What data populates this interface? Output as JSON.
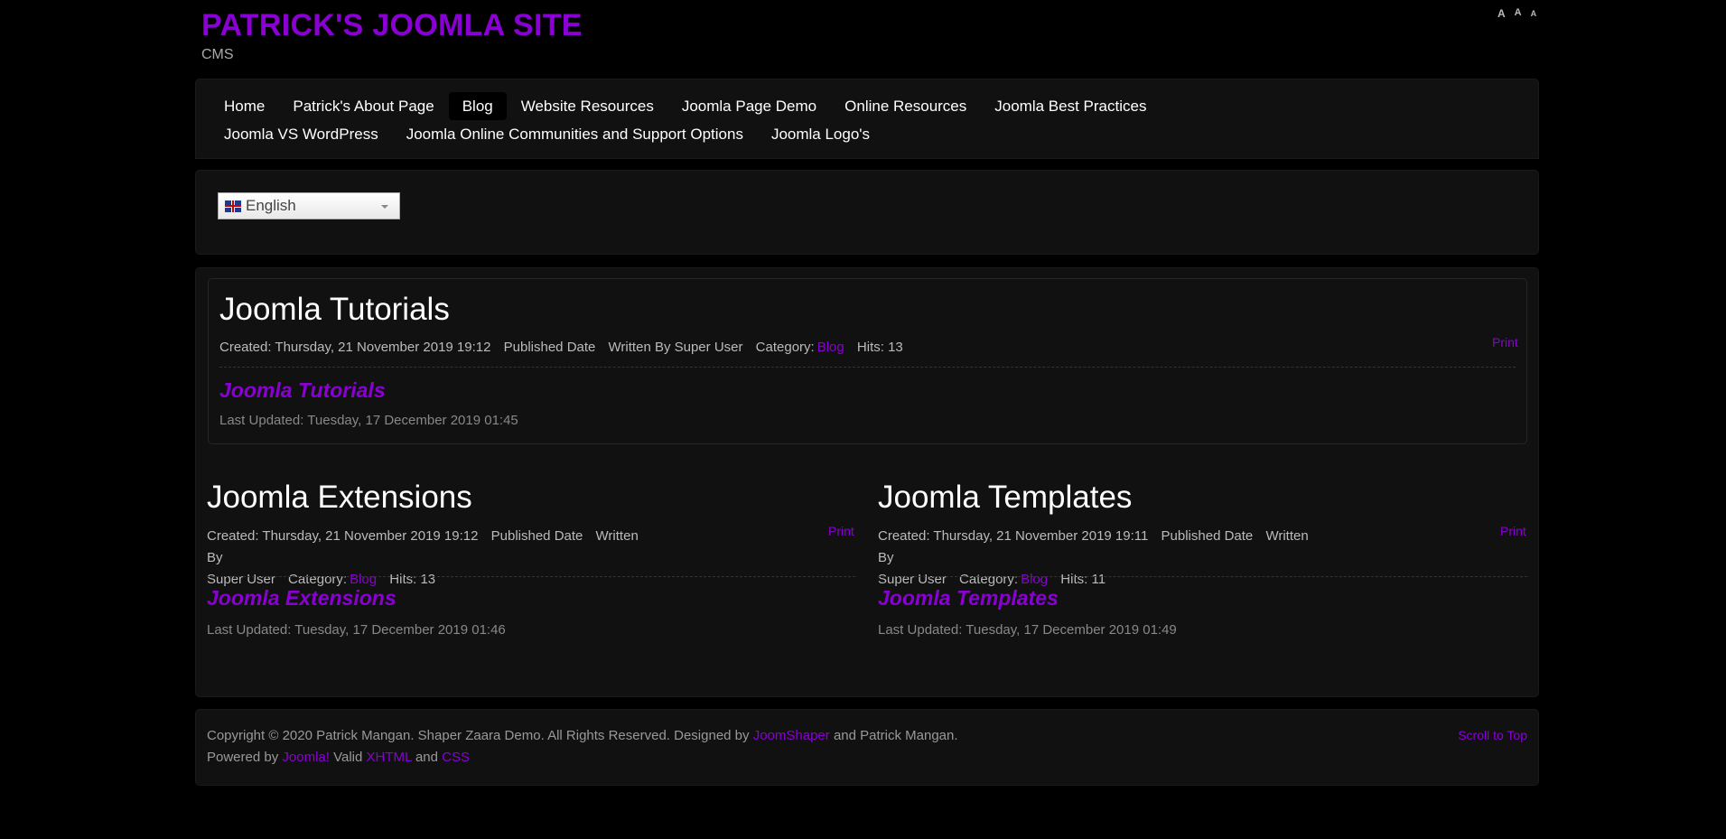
{
  "header": {
    "site_title": "PATRICK'S JOOMLA SITE",
    "tagline": "CMS",
    "font_sizes": [
      "A",
      "A",
      "A"
    ]
  },
  "nav": {
    "items": [
      {
        "label": "Home",
        "active": false
      },
      {
        "label": "Patrick's About Page",
        "active": false
      },
      {
        "label": "Blog",
        "active": true
      },
      {
        "label": "Website Resources",
        "active": false
      },
      {
        "label": "Joomla Page Demo",
        "active": false
      },
      {
        "label": "Online Resources",
        "active": false
      },
      {
        "label": "Joomla Best Practices",
        "active": false
      },
      {
        "label": "Joomla VS WordPress",
        "active": false
      },
      {
        "label": "Joomla Online Communities and Support Options",
        "active": false
      },
      {
        "label": "Joomla Logo's",
        "active": false
      }
    ]
  },
  "language": {
    "selected": "English",
    "flag_icon": "uk-flag-icon"
  },
  "articles": [
    {
      "title": "Joomla Tutorials",
      "created": "Created: Thursday, 21 November 2019 19:12",
      "published": "Published Date",
      "written_by": "Written By Super User",
      "category_label": "Category:",
      "category": "Blog",
      "hits": "Hits: 13",
      "print": "Print",
      "link": "Joomla Tutorials",
      "updated": "Last Updated: Tuesday, 17 December 2019 01:45"
    },
    {
      "title": "Joomla Extensions",
      "created": "Created: Thursday, 21 November 2019 19:12",
      "published": "Published Date",
      "written_by": "Written By",
      "written_by_2": "Super User",
      "category_label": "Category:",
      "category": "Blog",
      "hits": "Hits: 13",
      "print": "Print",
      "link": "Joomla Extensions",
      "updated": "Last Updated: Tuesday, 17 December 2019 01:46"
    },
    {
      "title": "Joomla Templates",
      "created": "Created: Thursday, 21 November 2019 19:11",
      "published": "Published Date",
      "written_by": "Written By",
      "written_by_2": "Super User",
      "category_label": "Category:",
      "category": "Blog",
      "hits": "Hits: 11",
      "print": "Print",
      "link": "Joomla Templates",
      "updated": "Last Updated: Tuesday, 17 December 2019 01:49"
    }
  ],
  "footer": {
    "copyright_pre": "Copyright © 2020 Patrick Mangan. Shaper Zaara Demo. All Rights Reserved. Designed by",
    "joomshaper": "JoomShaper",
    "copyright_post": "and Patrick Mangan.",
    "powered_by": "Powered by",
    "joomla": "Joomla!",
    "valid": "Valid",
    "xhtml": "XHTML",
    "and": "and",
    "css": "CSS",
    "scroll_top": "Scroll to Top"
  },
  "colors": {
    "accent": "#8a00d4",
    "background": "#000000",
    "panel": "#111111"
  }
}
